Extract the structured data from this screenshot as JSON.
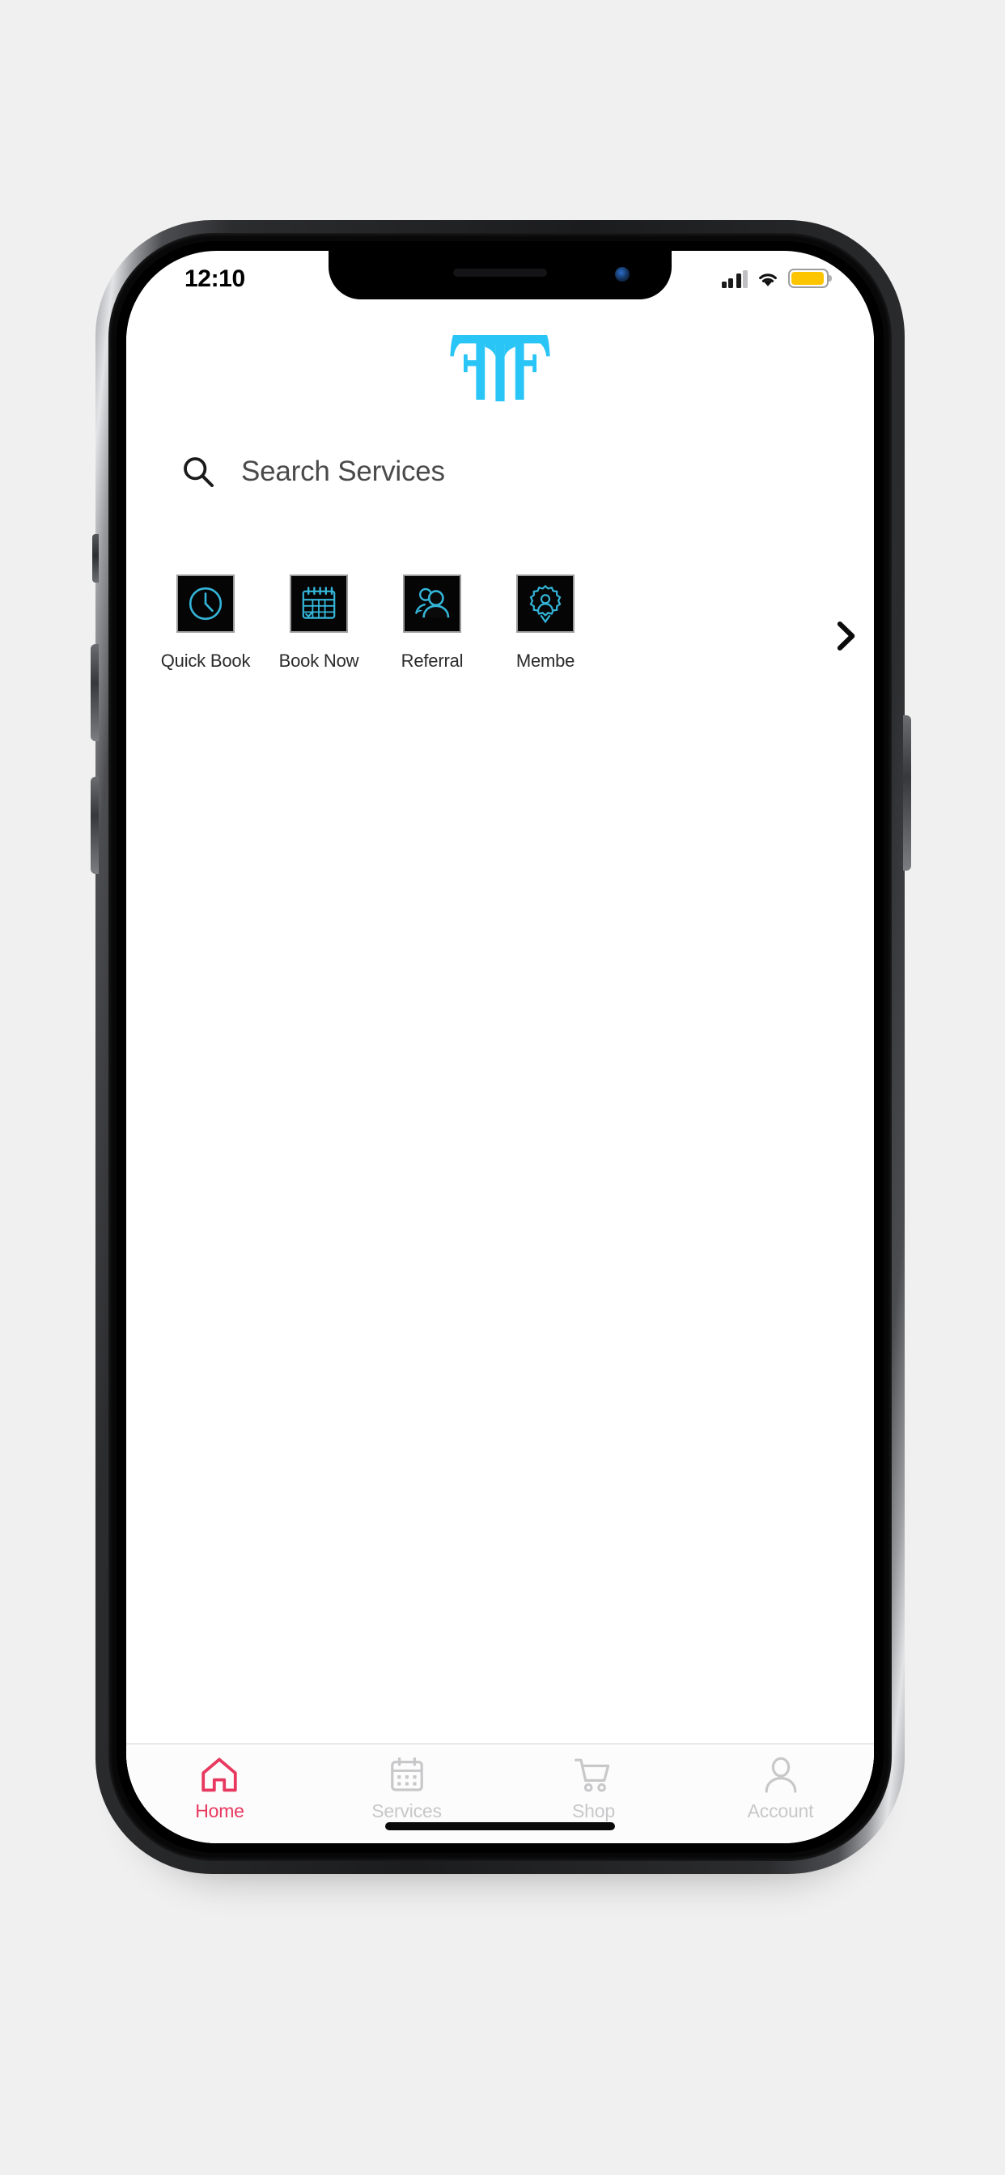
{
  "device": {
    "kind": "smartphone-mockup",
    "buttons": [
      "mute-switch",
      "volume-up",
      "volume-down",
      "power"
    ]
  },
  "status_bar": {
    "time": "12:10",
    "signal_icon": "cellular-signal-icon",
    "signal_bars_filled": 3,
    "signal_bars_total": 4,
    "wifi_icon": "wifi-icon",
    "battery_icon": "battery-icon",
    "battery_color": "#fdc500",
    "battery_level_percent": 80
  },
  "brand": {
    "logo_name": "double-f-monogram-logo",
    "logo_color": "#29c5f6"
  },
  "search": {
    "icon": "search-icon",
    "placeholder": "Search Services",
    "value": ""
  },
  "quick_actions": {
    "next_icon": "chevron-right-icon",
    "tile_bg": "#050505",
    "tile_icon_color": "#34b6d9",
    "items": [
      {
        "label": "Quick Book",
        "icon": "clock-icon"
      },
      {
        "label": "Book Now",
        "icon": "calendar-icon"
      },
      {
        "label": "Referral",
        "icon": "two-people-icon"
      },
      {
        "label": "Membe",
        "icon": "membership-badge-icon"
      }
    ]
  },
  "bottom_nav": {
    "active_color": "#e8385f",
    "inactive_color": "#c8c8ca",
    "items": [
      {
        "label": "Home",
        "icon": "home-icon",
        "active": true
      },
      {
        "label": "Services",
        "icon": "calendar-icon",
        "active": false
      },
      {
        "label": "Shop",
        "icon": "shopping-cart-icon",
        "active": false
      },
      {
        "label": "Account",
        "icon": "person-icon",
        "active": false
      }
    ]
  },
  "home_indicator": {
    "name": "home-indicator-bar"
  }
}
